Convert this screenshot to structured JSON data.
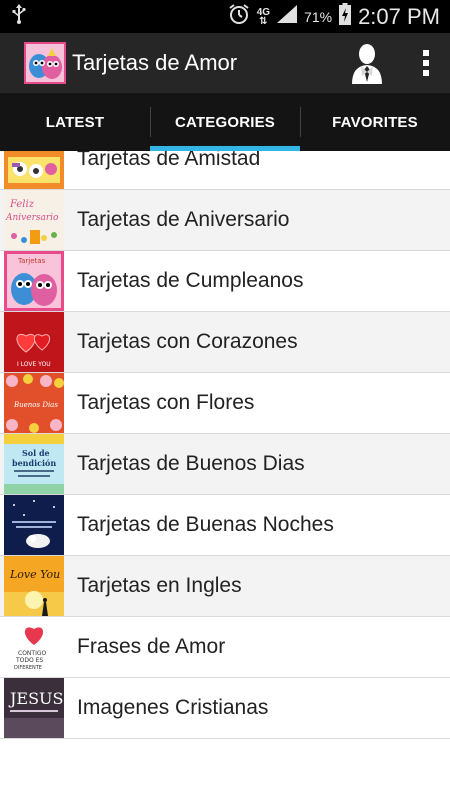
{
  "status_bar": {
    "battery_percent": "71%",
    "time": "2:07 PM",
    "network": "4G"
  },
  "app_bar": {
    "title": "Tarjetas de Amor",
    "logo_icon": "monsters-logo-icon",
    "profile_icon": "user-silhouette-icon",
    "menu_icon": "overflow-menu-icon"
  },
  "tabs": [
    {
      "label": "LATEST",
      "active": false
    },
    {
      "label": "CATEGORIES",
      "active": true
    },
    {
      "label": "FAVORITES",
      "active": false
    }
  ],
  "categories": [
    {
      "label": "Tarjetas de Amistad",
      "thumb_text": ""
    },
    {
      "label": "Tarjetas de Aniversario",
      "thumb_text": "Feliz Aniversario"
    },
    {
      "label": "Tarjetas de Cumpleanos",
      "thumb_text": "Tarjetas"
    },
    {
      "label": "Tarjetas con Corazones",
      "thumb_text": "I LOVE YOU"
    },
    {
      "label": "Tarjetas con Flores",
      "thumb_text": "Buenos Dias"
    },
    {
      "label": "Tarjetas de Buenos Dias",
      "thumb_text": "Sol de bendición"
    },
    {
      "label": "Tarjetas de Buenas Noches",
      "thumb_text": ""
    },
    {
      "label": "Tarjetas en Ingles",
      "thumb_text": "Love You"
    },
    {
      "label": "Frases de Amor",
      "thumb_text": "CONTIGO TODO ES DIFERENTE"
    },
    {
      "label": "Imagenes Cristianas",
      "thumb_text": "JESUS"
    }
  ],
  "colors": {
    "accent": "#33b5e5",
    "action_bar": "#262626",
    "tab_bar": "#141414"
  }
}
